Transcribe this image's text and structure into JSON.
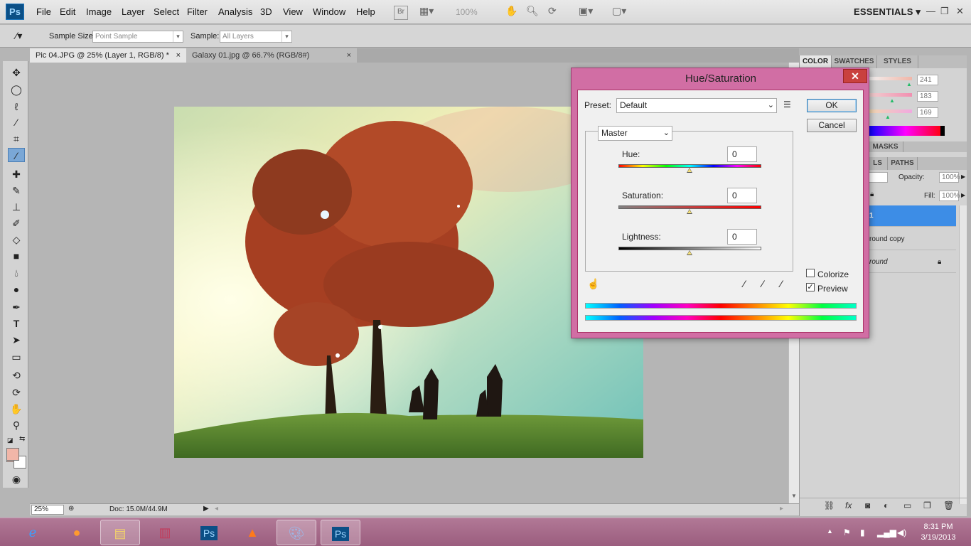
{
  "app": {
    "logo": "Ps",
    "menu": [
      "File",
      "Edit",
      "Image",
      "Layer",
      "Select",
      "Filter",
      "Analysis",
      "3D",
      "View",
      "Window",
      "Help"
    ],
    "br_button": "Br",
    "zoom_menu": "100%",
    "workspace": "ESSENTIALS"
  },
  "options": {
    "sample_size_label": "Sample Size:",
    "sample_size_value": "Point Sample",
    "sample_label": "Sample:",
    "sample_value": "All Layers"
  },
  "tabs": [
    {
      "label": "Pic 04.JPG @ 25% (Layer 1, RGB/8) *",
      "close": "×"
    },
    {
      "label": "Galaxy 01.jpg @ 66.7% (RGB/8#)",
      "close": "×"
    }
  ],
  "status": {
    "zoom": "25%",
    "doc": "Doc: 15.0M/44.9M"
  },
  "color_panel": {
    "tabs": [
      "COLOR",
      "SWATCHES",
      "STYLES"
    ],
    "values": [
      "241",
      "183",
      "169"
    ],
    "fg_color": "#f1b6a8"
  },
  "layers_panel": {
    "masks_tab": "MASKS",
    "tabs": [
      "LS",
      "PATHS"
    ],
    "opacity_label": "Opacity:",
    "opacity_value": "100%",
    "fill_label": "Fill:",
    "fill_value": "100%",
    "layers": [
      "1",
      "round copy",
      "round"
    ]
  },
  "dialog": {
    "title": "Hue/Saturation",
    "close": "✕",
    "preset_label": "Preset:",
    "preset_value": "Default",
    "ok": "OK",
    "cancel": "Cancel",
    "channel": "Master",
    "hue_label": "Hue:",
    "hue_value": "0",
    "saturation_label": "Saturation:",
    "saturation_value": "0",
    "lightness_label": "Lightness:",
    "lightness_value": "0",
    "colorize_label": "Colorize",
    "colorize_checked": false,
    "preview_label": "Preview",
    "preview_checked": true,
    "accent": "#d16ea4"
  },
  "taskbar": {
    "time": "8:31 PM",
    "date": "3/19/2013",
    "apps": [
      "internet-explorer-icon",
      "firefox-icon",
      "file-explorer-icon",
      "winrar-icon",
      "photoshop-icon",
      "matlab-icon",
      "paint-icon",
      "photoshop-icon"
    ]
  }
}
